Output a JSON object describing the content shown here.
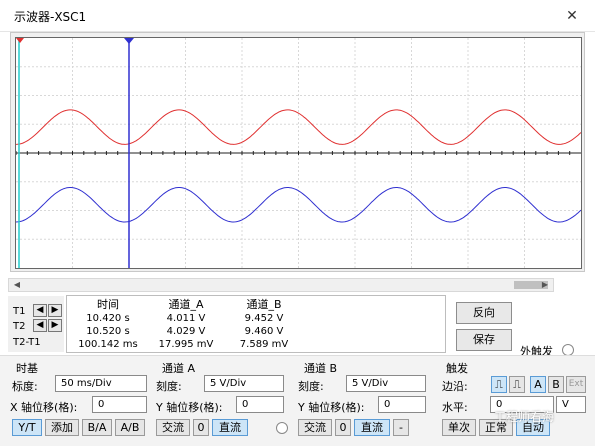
{
  "window": {
    "title": "示波器-XSC1",
    "close_glyph": "✕"
  },
  "readout": {
    "headers": [
      "时间",
      "通道_A",
      "通道_B"
    ],
    "rows": [
      {
        "label": "T1",
        "time": "10.420 s",
        "a": "4.011 V",
        "b": "9.452 V"
      },
      {
        "label": "T2",
        "time": "10.520 s",
        "a": "4.029 V",
        "b": "9.460 V"
      },
      {
        "label": "T2-T1",
        "time": "100.142 ms",
        "a": "17.995 mV",
        "b": "7.589 mV"
      }
    ]
  },
  "buttons": {
    "reverse": "反向",
    "save": "保存",
    "ext_trigger": "外触发"
  },
  "timebase": {
    "title": "时基",
    "scale_label": "标度:",
    "scale": "50 ms/Div",
    "xpos_label": "X 轴位移(格):",
    "xpos": "0",
    "modes": [
      "Y/T",
      "添加",
      "B/A",
      "A/B"
    ]
  },
  "channel_a": {
    "title": "通道 A",
    "scale_label": "刻度:",
    "scale": "5  V/Div",
    "ypos_label": "Y 轴位移(格):",
    "ypos": "0",
    "coupling": [
      "交流",
      "0",
      "直流"
    ]
  },
  "channel_b": {
    "title": "通道 B",
    "scale_label": "刻度:",
    "scale": "5  V/Div",
    "ypos_label": "Y 轴位移(格):",
    "ypos": "0",
    "coupling": [
      "交流",
      "0",
      "直流",
      "-"
    ]
  },
  "trigger": {
    "title": "触发",
    "edge_label": "边沿:",
    "edge_options": [
      "A",
      "B",
      "Ext"
    ],
    "level_label": "水平:",
    "level": "0",
    "level_unit": "V",
    "modes": [
      "单次",
      "正常",
      "自动"
    ]
  },
  "watermark": "工程师看海",
  "colors": {
    "channel_a": "#e03030",
    "channel_b": "#3030d0",
    "cursor1": "#22cccc",
    "cursor2": "#3030d0"
  },
  "chart_data": {
    "type": "line",
    "series": [
      {
        "name": "通道_A",
        "color": "#e03030",
        "offset_div": 0.9,
        "amplitude_div": 0.6,
        "cycles": 5.2
      },
      {
        "name": "通道_B",
        "color": "#3030d0",
        "offset_div": -1.8,
        "amplitude_div": 0.6,
        "cycles": 5.2
      }
    ],
    "grid": true
  }
}
